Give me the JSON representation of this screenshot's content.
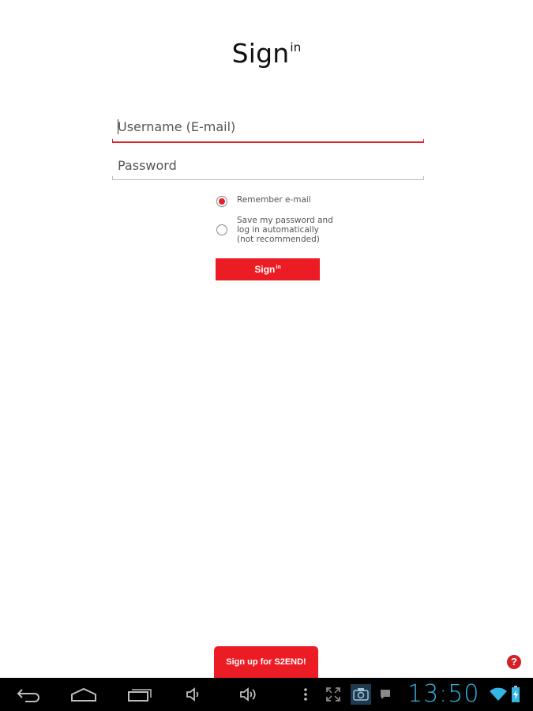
{
  "title": {
    "main": "Sign",
    "sup": "in"
  },
  "form": {
    "username_placeholder": "Username (E-mail)",
    "username_value": "",
    "password_placeholder": "Password",
    "password_value": "",
    "remember_email": {
      "label": "Remember e-mail",
      "checked": true
    },
    "save_password": {
      "line1": "Save my password and",
      "line2": "log in automatically",
      "line3": "(not recommended)",
      "checked": false
    },
    "signin_button": {
      "main": "Sign",
      "sup": "in"
    }
  },
  "signup_button": "Sign up for S2END!",
  "help_icon": "?",
  "statusbar": {
    "clock": "13:50",
    "icons": [
      "back-icon",
      "home-icon",
      "recent-apps-icon",
      "volume-down-icon",
      "volume-up-icon",
      "menu-icon",
      "fullscreen-icon",
      "screenshot-icon",
      "notification-icon",
      "wifi-icon",
      "battery-icon"
    ]
  },
  "colors": {
    "accent": "#ec1c24",
    "clock": "#33b5e5"
  }
}
